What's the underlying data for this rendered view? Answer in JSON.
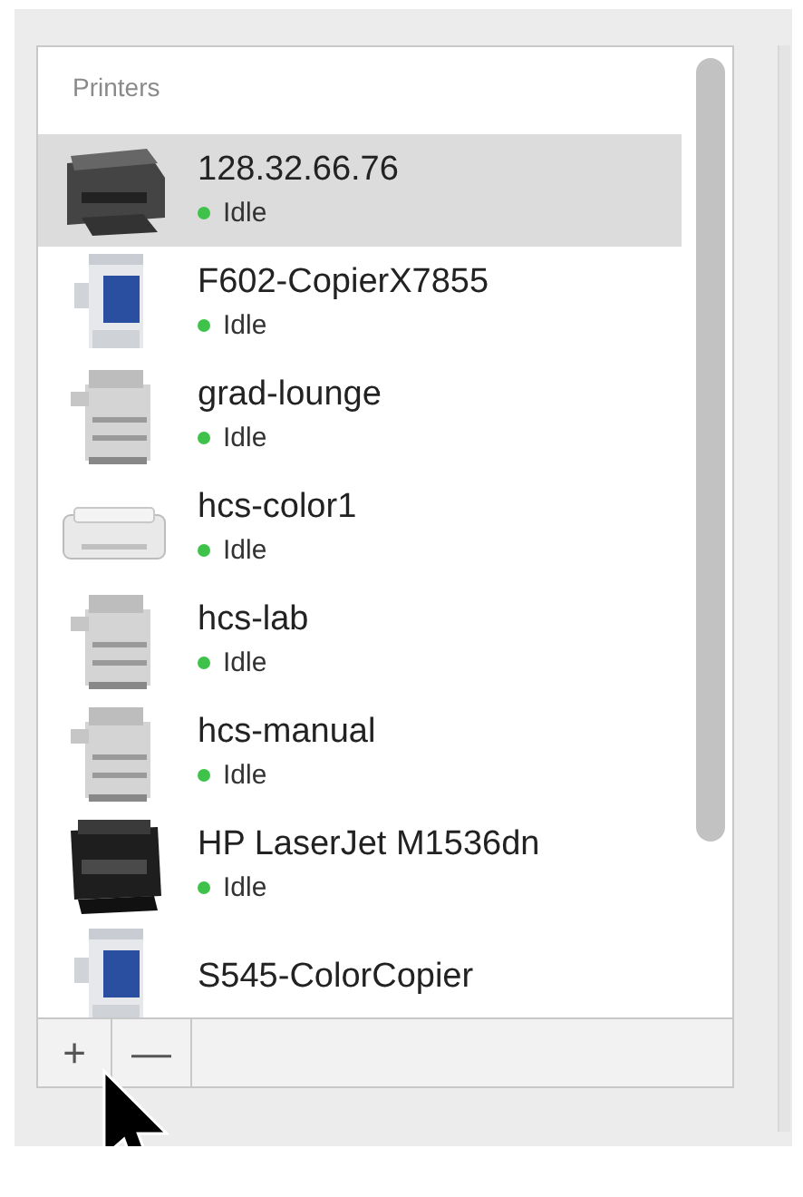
{
  "list": {
    "header": "Printers",
    "printers": [
      {
        "name": "128.32.66.76",
        "status": "Idle",
        "selected": true,
        "kind": "multifunction"
      },
      {
        "name": "F602-CopierX7855",
        "status": "Idle",
        "selected": false,
        "kind": "copier"
      },
      {
        "name": "grad-lounge",
        "status": "Idle",
        "selected": false,
        "kind": "tower"
      },
      {
        "name": "hcs-color1",
        "status": "Idle",
        "selected": false,
        "kind": "desktop"
      },
      {
        "name": "hcs-lab",
        "status": "Idle",
        "selected": false,
        "kind": "tower"
      },
      {
        "name": "hcs-manual",
        "status": "Idle",
        "selected": false,
        "kind": "tower"
      },
      {
        "name": "HP LaserJet M1536dn",
        "status": "Idle",
        "selected": false,
        "kind": "laser"
      },
      {
        "name": "S545-ColorCopier",
        "selected": false,
        "kind": "copier"
      }
    ]
  },
  "buttons": [
    {
      "label": "+"
    },
    {
      "label": "—"
    }
  ]
}
